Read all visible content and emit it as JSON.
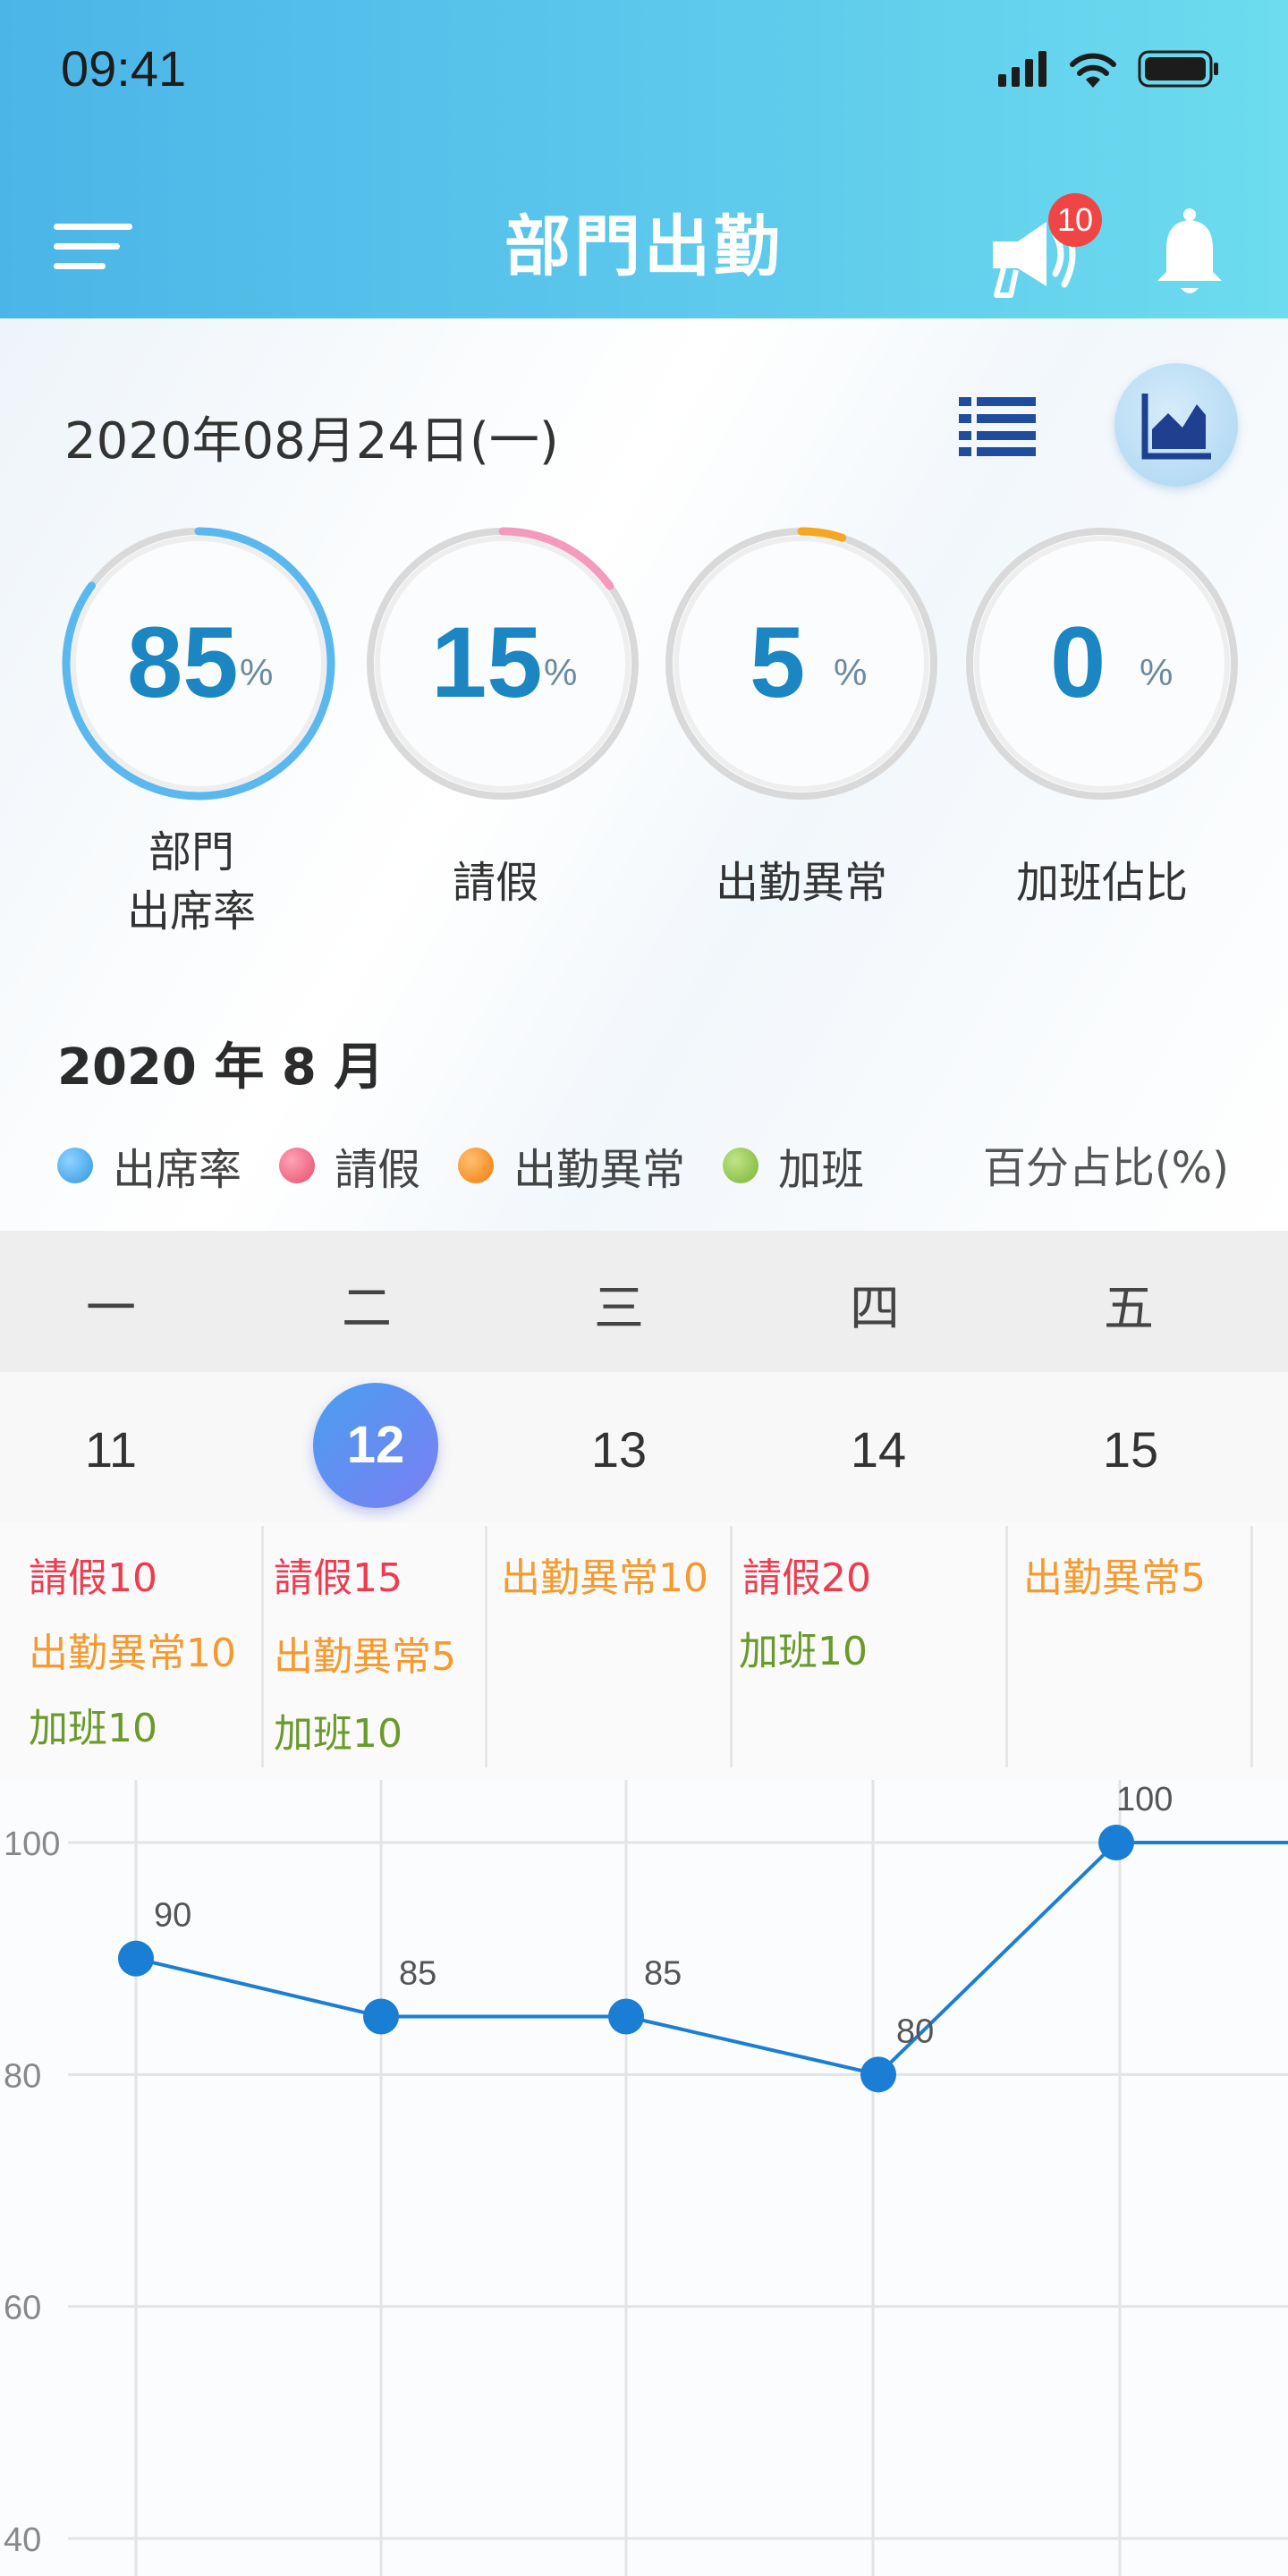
{
  "status_bar": {
    "time": "09:41"
  },
  "header": {
    "title": "部門出勤",
    "notification_badge": "10"
  },
  "date_label": "2020年08月24日(一)",
  "gauges": [
    {
      "value": "85",
      "unit": "%",
      "label_line1": "部門",
      "label_line2": "出席率",
      "fraction": 0.85,
      "color": "#5bb8ee"
    },
    {
      "value": "15",
      "unit": "%",
      "label_line1": "",
      "label_line2": "請假",
      "fraction": 0.15,
      "color": "#f49bbd"
    },
    {
      "value": "5",
      "unit": "%",
      "label_line1": "",
      "label_line2": "出勤異常",
      "fraction": 0.05,
      "color": "#f5a623"
    },
    {
      "value": "0",
      "unit": "%",
      "label_line1": "",
      "label_line2": "加班佔比",
      "fraction": 0,
      "color": "#7cc04a"
    }
  ],
  "month_title": "2020 年 8 月",
  "legend": [
    {
      "label": "出席率",
      "color": "#3aa6ea"
    },
    {
      "label": "請假",
      "color": "#f2607f"
    },
    {
      "label": "出勤異常",
      "color": "#f58a12"
    },
    {
      "label": "加班",
      "color": "#8cc63e"
    }
  ],
  "legend_note": "百分占比(%)",
  "weekdays": [
    "一",
    "二",
    "三",
    "四",
    "五"
  ],
  "dates": [
    "11",
    "12",
    "13",
    "14",
    "15"
  ],
  "selected_date": "12",
  "events": [
    [
      "請假10",
      "出勤異常10",
      "加班10"
    ],
    [
      "請假15",
      "出勤異常5",
      "加班10"
    ],
    [
      "出勤異常10"
    ],
    [
      "請假20",
      "加班10"
    ],
    [
      "出勤異常5"
    ]
  ],
  "chart_data": {
    "type": "line",
    "x": [
      "11",
      "12",
      "13",
      "14",
      "15"
    ],
    "series": [
      {
        "values": [
          90,
          85,
          85,
          80,
          100
        ]
      }
    ],
    "y_ticks": [
      40,
      60,
      80,
      100
    ],
    "ylim": [
      40,
      100
    ],
    "grid": true,
    "line_color": "#1a7fd4"
  }
}
